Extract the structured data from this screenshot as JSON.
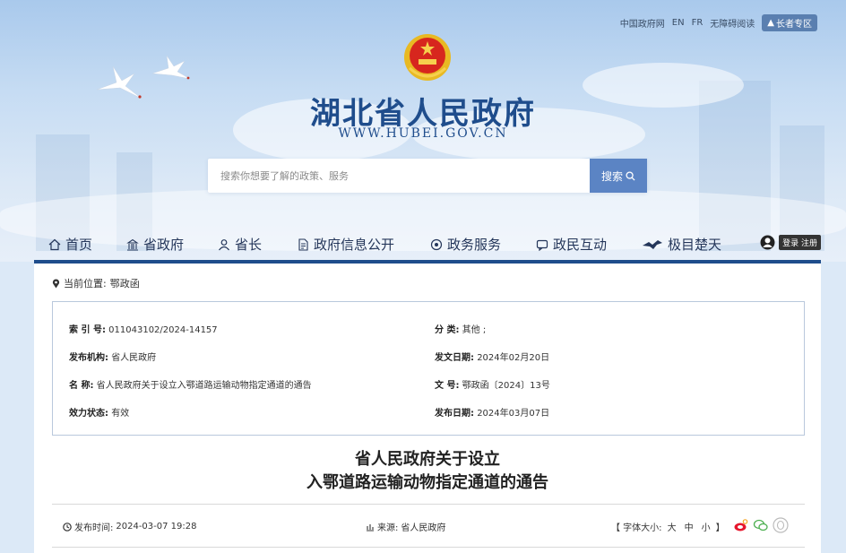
{
  "header": {
    "top_links": [
      "中国政府网",
      "EN",
      "FR",
      "无障碍阅读"
    ],
    "elder_zone": "长者专区",
    "site_title": "湖北省人民政府",
    "site_url": "WWW.HUBEI.GOV.CN"
  },
  "search": {
    "placeholder": "搜索你想要了解的政策、服务",
    "button_label": "搜索"
  },
  "nav": {
    "items": [
      {
        "label": "首页",
        "icon": "home-icon"
      },
      {
        "label": "省政府",
        "icon": "building-icon"
      },
      {
        "label": "省长",
        "icon": "person-icon"
      },
      {
        "label": "政府信息公开",
        "icon": "document-icon"
      },
      {
        "label": "政务服务",
        "icon": "service-icon"
      },
      {
        "label": "政民互动",
        "icon": "chat-icon"
      },
      {
        "label": "极目楚天",
        "icon": "bird-icon"
      }
    ],
    "login_label": "登录 注册"
  },
  "breadcrumb": {
    "prefix": "当前位置:",
    "current": "鄂政函"
  },
  "meta": {
    "index_label": "索 引 号:",
    "index_value": "011043102/2024-14157",
    "category_label": "分 类:",
    "category_value": "其他 ;",
    "publisher_label": "发布机构:",
    "publisher_value": "省人民政府",
    "issue_date_label": "发文日期:",
    "issue_date_value": "2024年02月20日",
    "name_label": "名 称:",
    "name_value": "省人民政府关于设立入鄂道路运输动物指定通道的通告",
    "doc_no_label": "文 号:",
    "doc_no_value": "鄂政函〔2024〕13号",
    "status_label": "效力状态:",
    "status_value": "有效",
    "publish_date_label": "发布日期:",
    "publish_date_value": "2024年03月07日"
  },
  "document": {
    "title_line1": "省人民政府关于设立",
    "title_line2": "入鄂道路运输动物指定通道的通告"
  },
  "info": {
    "publish_time_label": "发布时间:",
    "publish_time": "2024-03-07 19:28",
    "source_label": "来源:",
    "source": "省人民政府",
    "font_size_label": "【 字体大小:",
    "font_large": "大",
    "font_medium": "中",
    "font_small": "小",
    "font_end": "】"
  },
  "colors": {
    "brand": "#1f4d8c",
    "search_button": "#5b84c4"
  }
}
